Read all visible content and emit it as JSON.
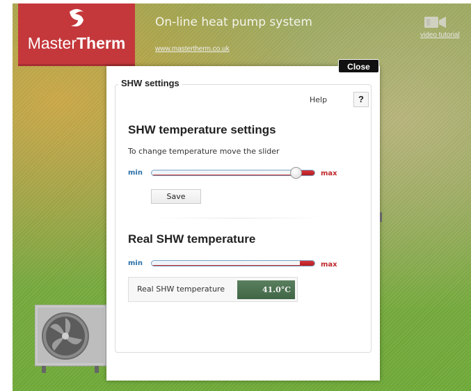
{
  "header": {
    "brand": {
      "prefix": "Master",
      "bold": "Therm"
    },
    "title": "On-line heat pump system",
    "link": "www.mastertherm.co.uk",
    "video_label": "video tutorial"
  },
  "modal": {
    "close_label": "Close",
    "legend": "SHW settings",
    "help_label": "Help",
    "help_button": "?",
    "settings": {
      "title": "SHW temperature settings",
      "instruction": "To change temperature move the slider",
      "min_label": "min",
      "max_label": "max",
      "slider_position": 0.92,
      "save_label": "Save"
    },
    "real": {
      "title": "Real SHW temperature",
      "min_label": "min",
      "max_label": "max",
      "bar_level": 0.92,
      "readout_label": "Real SHW temperature",
      "readout_value": "41.0°C"
    }
  },
  "colors": {
    "logo_red": "#c4383c",
    "min_blue": "#2a6fa8",
    "max_red": "#c0282a",
    "readout_green": "#4c7352"
  },
  "icons": {
    "logo": "mastertherm-swirl-icon",
    "video": "video-camera-icon",
    "help": "question-mark-icon"
  }
}
